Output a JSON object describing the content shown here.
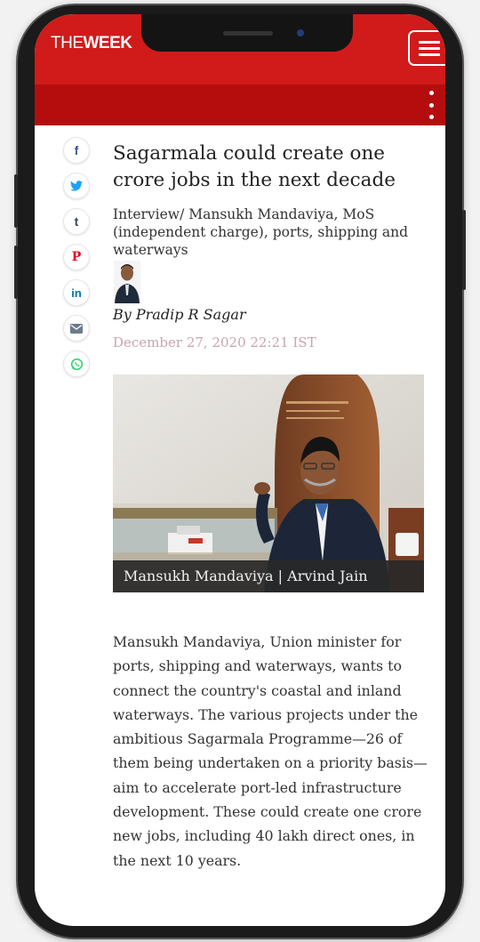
{
  "header": {
    "logo_the": "THE",
    "logo_week": "WEEK",
    "menu_icon": "hamburger-menu-icon",
    "more_icon": "vertical-ellipsis-icon",
    "brand_color": "#d11a1a"
  },
  "share_buttons": [
    {
      "icon": "facebook-icon",
      "glyph": "f",
      "color": "#3b5998"
    },
    {
      "icon": "twitter-icon",
      "glyph": "🐦",
      "color": "#1da1f2"
    },
    {
      "icon": "tumblr-icon",
      "glyph": "t",
      "color": "#35465c"
    },
    {
      "icon": "pinterest-icon",
      "glyph": "P",
      "color": "#e60023"
    },
    {
      "icon": "linkedin-icon",
      "glyph": "in",
      "color": "#0077b5"
    },
    {
      "icon": "email-icon",
      "glyph": "✉",
      "color": "#6b7a8f"
    },
    {
      "icon": "whatsapp-icon",
      "glyph": "✆",
      "color": "#25d366"
    }
  ],
  "article": {
    "title": "Sagarmala could create one crore jobs in the next decade",
    "subtitle": "Interview/ Mansukh Mandaviya, MoS (independent charge), ports, shipping and waterways",
    "byline": "By Pradip R Sagar",
    "date": "December 27, 2020 22:21 IST",
    "photo_caption": "Mansukh Mandaviya | Arvind Jain",
    "body": "Mansukh Mandaviya, Union minister for ports, shipping and waterways, wants to connect the country's coastal and inland waterways. The various projects under the ambitious Sagarmala Programme—26 of them being undertaken on a priority basis—aim to accelerate port-led infrastructure development. These could create one crore new jobs, including 40 lakh direct ones, in the next 10 years."
  }
}
